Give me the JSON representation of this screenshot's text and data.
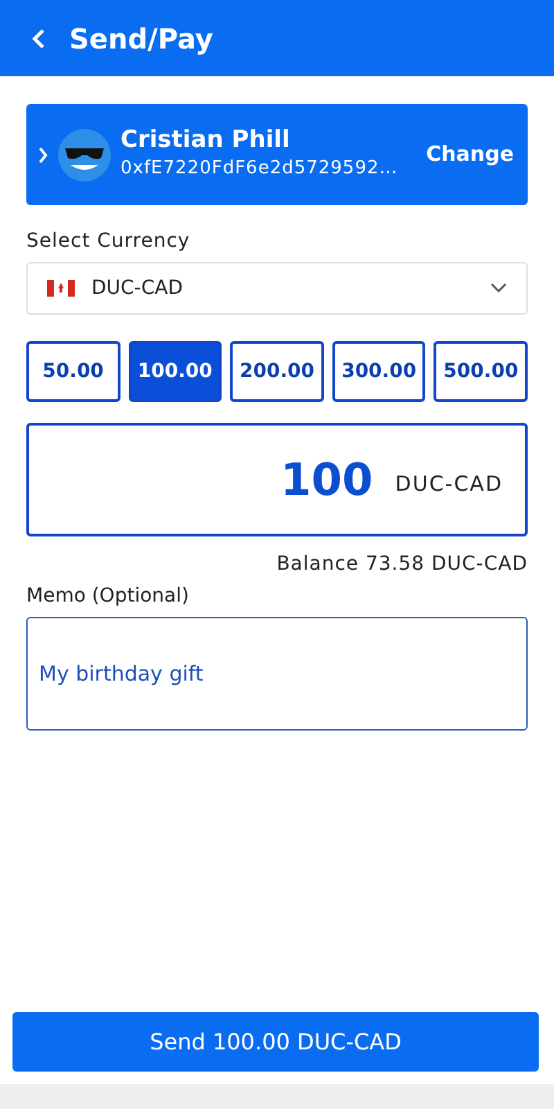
{
  "header": {
    "title": "Send/Pay"
  },
  "recipient": {
    "name": "Cristian Phill",
    "address": "0xfE7220FdF6e2d5729592…",
    "action": "Change"
  },
  "currency": {
    "label": "Select Currency",
    "value": "DUC-CAD"
  },
  "presets": [
    {
      "label": "50.00",
      "selected": false
    },
    {
      "label": "100.00",
      "selected": true
    },
    {
      "label": "200.00",
      "selected": false
    },
    {
      "label": "300.00",
      "selected": false
    },
    {
      "label": "500.00",
      "selected": false
    }
  ],
  "amount": {
    "value": "100",
    "unit": "DUC-CAD"
  },
  "balance": "Balance 73.58 DUC-CAD",
  "memo": {
    "label": "Memo (Optional)",
    "value": "My birthday gift"
  },
  "send_button": "Send 100.00 DUC-CAD"
}
